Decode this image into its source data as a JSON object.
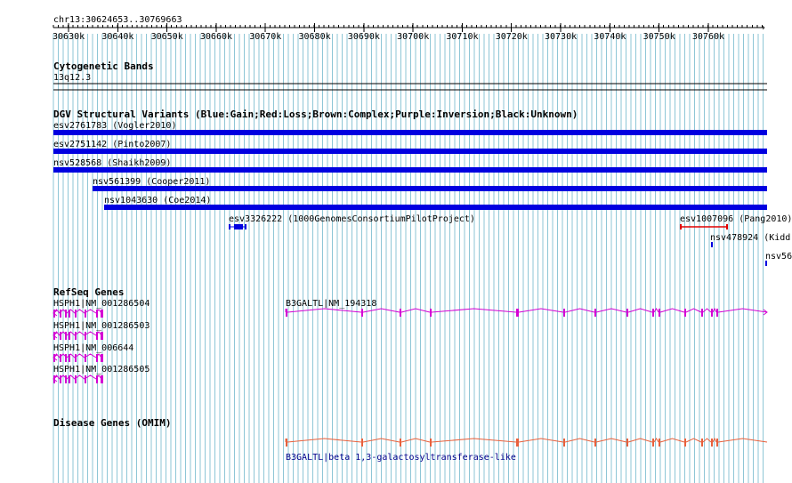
{
  "region": "chr13:30624653..30769663",
  "ruler": {
    "ticks": [
      "30630k",
      "30640k",
      "30650k",
      "30660k",
      "30670k",
      "30680k",
      "30690k",
      "30700k",
      "30710k",
      "30720k",
      "30730k",
      "30740k",
      "30750k",
      "30760k"
    ]
  },
  "cytobands": {
    "title": "Cytogenetic Bands",
    "band": "13q12.3"
  },
  "dgv": {
    "title": "DGV Structural Variants (Blue:Gain;Red:Loss;Brown:Complex;Purple:Inversion;Black:Unknown)",
    "variants": [
      {
        "label": "esv2761783 (Vogler2010)",
        "color": "#0000e0"
      },
      {
        "label": "esv2751142 (Pinto2007)",
        "color": "#0000e0"
      },
      {
        "label": "nsv528568 (Shaikh2009)",
        "color": "#0000e0"
      },
      {
        "label": "nsv561399 (Cooper2011)",
        "color": "#0000e0"
      },
      {
        "label": "nsv1043630 (Coe2014)",
        "color": "#0000e0"
      },
      {
        "label": "esv3326222 (1000GenomesConsortiumPilotProject)",
        "color": "#0000e0"
      },
      {
        "label": "esv1007096 (Pang2010)",
        "color": "#e00000"
      },
      {
        "label": "nsv478924 (Kidd",
        "color": "#0000e0"
      },
      {
        "label": "nsv56",
        "color": "#0000e0"
      }
    ]
  },
  "refseq": {
    "title": "RefSeq Genes",
    "genes": [
      {
        "label": "HSPH1|NM_001286504"
      },
      {
        "label": "HSPH1|NM_001286503"
      },
      {
        "label": "HSPH1|NM_006644"
      },
      {
        "label": "HSPH1|NM_001286505"
      },
      {
        "label": "B3GALTL|NM_194318"
      }
    ],
    "color": "#d400d4"
  },
  "omim": {
    "title": "Disease Genes (OMIM)",
    "gene_label": "B3GALTL|beta 1,3-galactosyltransferase-like",
    "color": "#e8603c"
  }
}
